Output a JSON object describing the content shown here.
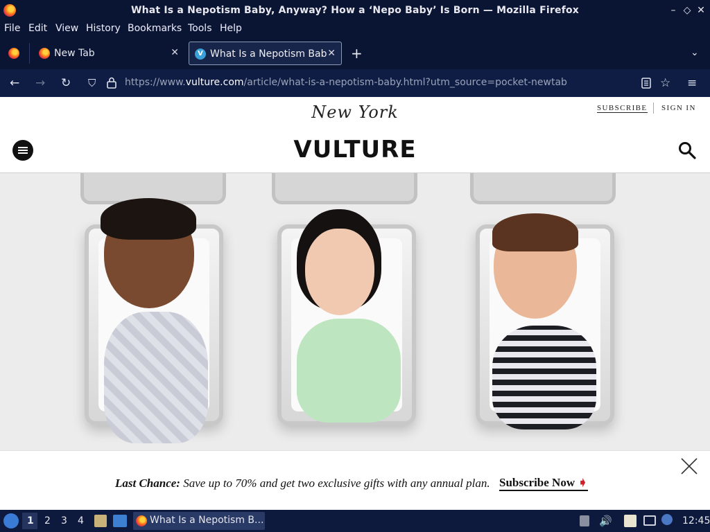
{
  "window": {
    "title": "What Is a Nepotism Baby, Anyway? How a ‘Nepo Baby’ Is Born — Mozilla Firefox",
    "controls": [
      "minimize",
      "restore",
      "close"
    ]
  },
  "menubar": {
    "items": [
      "File",
      "Edit",
      "View",
      "History",
      "Bookmarks",
      "Tools",
      "Help"
    ]
  },
  "tabs": [
    {
      "label": "New Tab",
      "active": false
    },
    {
      "label": "What Is a Nepotism Baby",
      "active": true
    }
  ],
  "navbar": {
    "url_prefix": "https://www.",
    "url_domain": "vulture.com",
    "url_path": "/article/what-is-a-nepotism-baby.html?utm_source=pocket-newtab"
  },
  "site": {
    "masthead": "New York",
    "logo": "VULTURE",
    "subscribe": "SUBSCRIBE",
    "signin": "SIGN IN"
  },
  "promo": {
    "lead": "Last Chance:",
    "body": "Save up to 70% and get two exclusive gifts with any annual plan.",
    "cta": "Subscribe Now",
    "cta_arrow": "➧"
  },
  "taskbar": {
    "workspaces": [
      "1",
      "2",
      "3",
      "4"
    ],
    "window_label": "What Is a Nepotism B...",
    "clock": "12:45"
  },
  "colors": {
    "chrome_bg": "#0a1534",
    "navbar_bg": "#0f1d45",
    "accent_red": "#d0202a"
  }
}
